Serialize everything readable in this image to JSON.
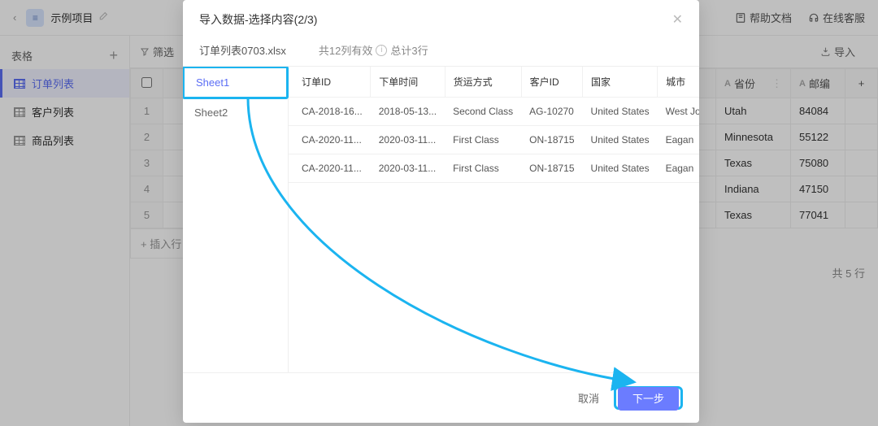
{
  "topbar": {
    "back": "‹",
    "proj_icon": "≡",
    "proj_name": "示例项目",
    "help_docs": "帮助文档",
    "online_support": "在线客服"
  },
  "sidebar": {
    "header": "表格",
    "items": [
      {
        "label": "订单列表",
        "active": true
      },
      {
        "label": "客户列表",
        "active": false
      },
      {
        "label": "商品列表",
        "active": false
      }
    ]
  },
  "toolbar": {
    "filter": "筛选",
    "import": "导入"
  },
  "bg_table": {
    "columns": [
      {
        "type": "A",
        "label": "省份"
      },
      {
        "type": "A",
        "label": "邮编"
      }
    ],
    "rows": [
      {
        "province": "Utah",
        "zip": "84084"
      },
      {
        "province": "Minnesota",
        "zip": "55122"
      },
      {
        "province": "Texas",
        "zip": "75080"
      },
      {
        "province": "Indiana",
        "zip": "47150"
      },
      {
        "province": "Texas",
        "zip": "77041"
      }
    ],
    "insert_row": "+ 插入行",
    "row_count": "共 5 行"
  },
  "modal": {
    "title": "导入数据-选择内容(2/3)",
    "filename": "订单列表0703.xlsx",
    "valid_cols": "共12列有效",
    "total_rows": "总计3行",
    "sheets": [
      {
        "label": "Sheet1",
        "active": true
      },
      {
        "label": "Sheet2",
        "active": false
      }
    ],
    "preview_headers": [
      "订单ID",
      "下单时间",
      "货运方式",
      "客户ID",
      "国家",
      "城市"
    ],
    "preview_rows": [
      [
        "CA-2018-16...",
        "2018-05-13...",
        "Second Class",
        "AG-10270",
        "United States",
        "West Jord"
      ],
      [
        "CA-2020-11...",
        "2020-03-11...",
        "First Class",
        "ON-18715",
        "United States",
        "Eagan"
      ],
      [
        "CA-2020-11...",
        "2020-03-11...",
        "First Class",
        "ON-18715",
        "United States",
        "Eagan"
      ]
    ],
    "cancel": "取消",
    "next": "下一步"
  }
}
